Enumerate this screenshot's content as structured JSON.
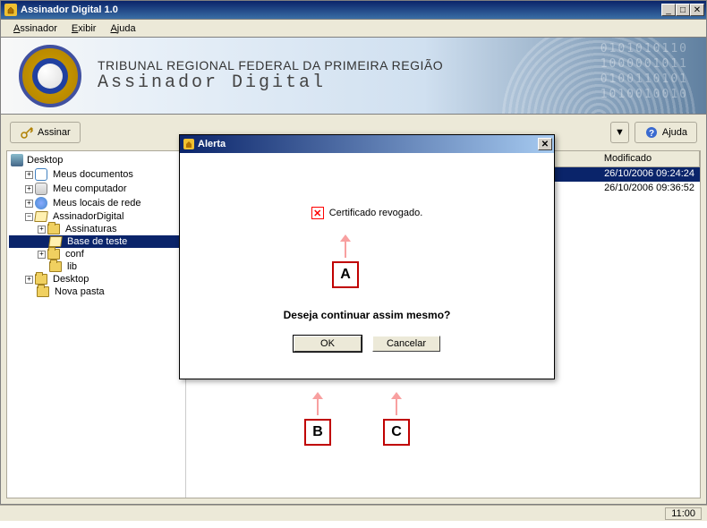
{
  "window": {
    "title": "Assinador Digital 1.0"
  },
  "menu": {
    "items": [
      {
        "label": "Assinador",
        "accel": "A"
      },
      {
        "label": "Exibir",
        "accel": "E"
      },
      {
        "label": "Ajuda",
        "accel": "A"
      }
    ]
  },
  "banner": {
    "heading": "TRIBUNAL REGIONAL FEDERAL DA PRIMEIRA REGIÃO",
    "subheading": "Assinador Digital"
  },
  "toolbar": {
    "assinar_label": "Assinar",
    "ajuda_label": "Ajuda"
  },
  "tree": {
    "root_label": "Desktop",
    "nodes": [
      {
        "label": "Meus documentos",
        "icon": "doc",
        "toggle": "+",
        "indent": 1
      },
      {
        "label": "Meu computador",
        "icon": "drive",
        "toggle": "+",
        "indent": 1
      },
      {
        "label": "Meus locais de rede",
        "icon": "net",
        "toggle": "+",
        "indent": 1
      },
      {
        "label": "AssinadorDigital",
        "icon": "folder-open",
        "toggle": "−",
        "indent": 1
      },
      {
        "label": "Assinaturas",
        "icon": "folder-closed",
        "toggle": "+",
        "indent": 2
      },
      {
        "label": "Base de teste",
        "icon": "folder-open",
        "toggle": "",
        "indent": 2,
        "selected": true
      },
      {
        "label": "conf",
        "icon": "folder-closed",
        "toggle": "+",
        "indent": 2
      },
      {
        "label": "lib",
        "icon": "folder-closed",
        "toggle": "",
        "indent": 2
      },
      {
        "label": "Desktop",
        "icon": "folder-closed",
        "toggle": "+",
        "indent": 1
      },
      {
        "label": "Nova pasta",
        "icon": "folder-closed",
        "toggle": "",
        "indent": 1
      }
    ]
  },
  "list": {
    "header_modificado": "Modificado",
    "rows": [
      {
        "modificado": "26/10/2006 09:24:24",
        "selected": true
      },
      {
        "modificado": "26/10/2006 09:36:52",
        "selected": false
      }
    ]
  },
  "modal": {
    "title": "Alerta",
    "message": "Certificado revogado.",
    "question": "Deseja continuar assim mesmo?",
    "ok_label": "OK",
    "cancel_label": "Cancelar"
  },
  "callouts": {
    "a": "A",
    "b": "B",
    "c": "C"
  },
  "status": {
    "time": "11:00"
  }
}
